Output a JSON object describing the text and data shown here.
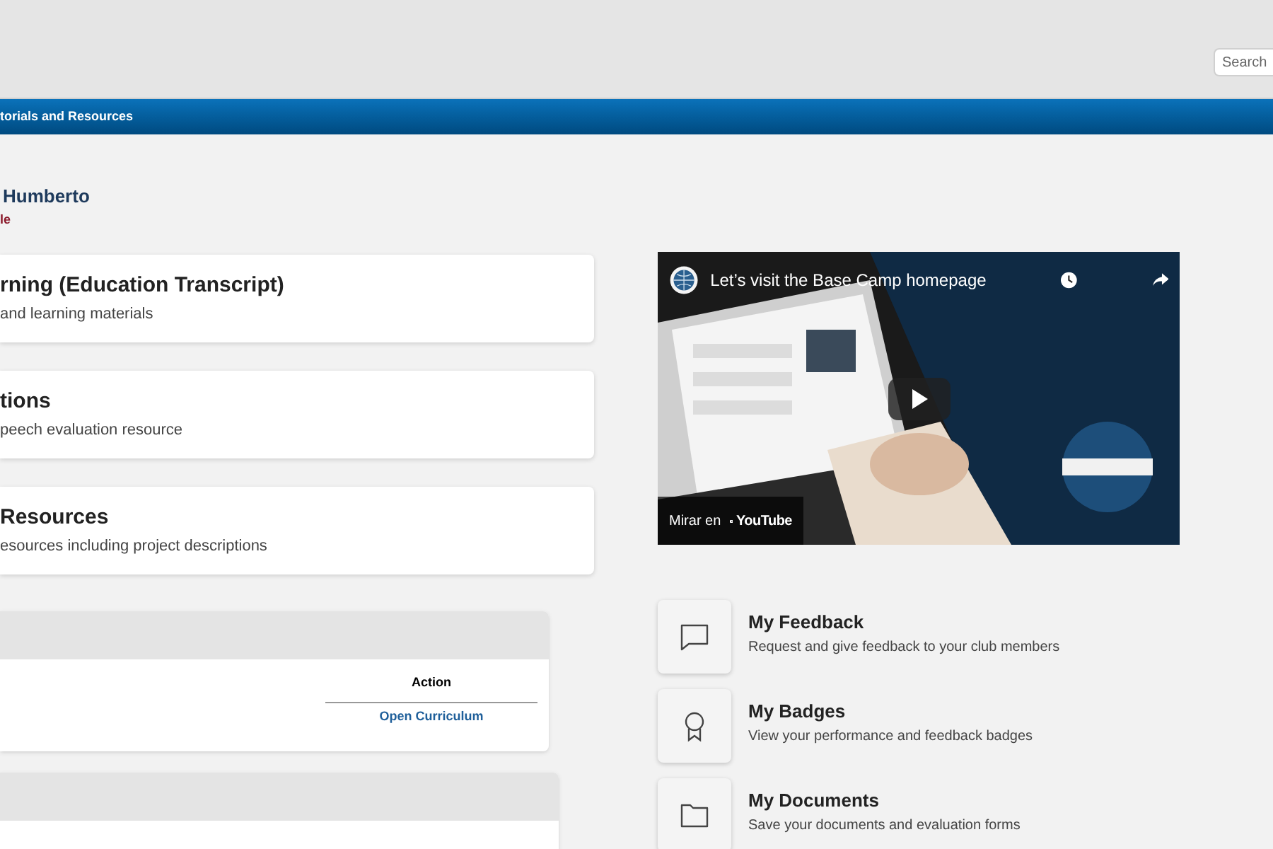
{
  "header": {
    "search": {
      "placeholder": "Search"
    }
  },
  "nav": {
    "items": [
      {
        "label": "torials and Resources"
      }
    ]
  },
  "greeting": {
    "name": "Humberto",
    "subtitle": "le"
  },
  "cards": [
    {
      "title": "rning (Education Transcript)",
      "description": "and learning materials"
    },
    {
      "title": "tions",
      "description": "peech evaluation resource"
    },
    {
      "title": "Resources",
      "description": "esources including project descriptions"
    }
  ],
  "curriculum_table": {
    "columns": [
      "Action"
    ],
    "rows": [
      {
        "action": "Open Curriculum"
      }
    ]
  },
  "video": {
    "title": "Let’s visit the Base Camp homepage",
    "watch_on": "Mirar en",
    "platform": "YouTube"
  },
  "shortcuts": [
    {
      "kind": "feedback",
      "title": "My Feedback",
      "description": "Request and give feedback to your club members"
    },
    {
      "kind": "badges",
      "title": "My Badges",
      "description": "View your performance and feedback badges"
    },
    {
      "kind": "documents",
      "title": "My Documents",
      "description": "Save your documents and evaluation forms"
    }
  ]
}
